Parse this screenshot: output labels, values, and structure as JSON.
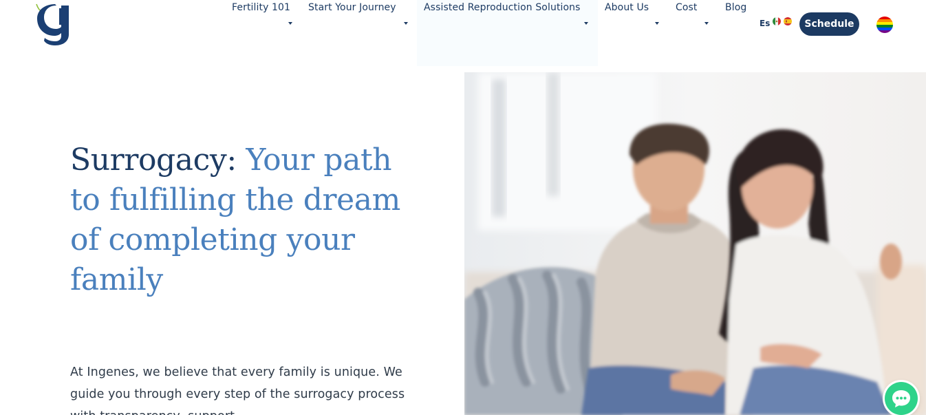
{
  "header": {
    "logo_alt": "Ingenes",
    "nav": [
      {
        "label": "Fertility 101",
        "has_dropdown": true
      },
      {
        "label": "Start Your Journey",
        "has_dropdown": true
      },
      {
        "label": "Assisted Reproduction Solutions",
        "has_dropdown": true,
        "active": true
      },
      {
        "label": "About Us",
        "has_dropdown": true
      },
      {
        "label": "Cost",
        "has_dropdown": true
      },
      {
        "label": "Blog",
        "has_dropdown": false
      }
    ],
    "language": "Es",
    "schedule_label": "Schedule",
    "accent_color": "#1c3a62"
  },
  "hero": {
    "title_dark": "Surrogacy:",
    "title_light": "Your path to fulfilling the dream of completing your family",
    "description": "At Ingenes, we believe that every family is unique. We guide you through every step of the surrogacy process with transparency, support",
    "title_color": "#1d3b63",
    "title_accent_color": "#4a80bd",
    "image_alt": "Smiling couple sitting on a sofa"
  },
  "icons": {
    "logo": "ingenes-g-logo",
    "chat": "chat-bubble-icon",
    "pride": "pride-flag-icon",
    "flags": [
      "mexico-flag-icon",
      "spain-flag-icon"
    ]
  }
}
